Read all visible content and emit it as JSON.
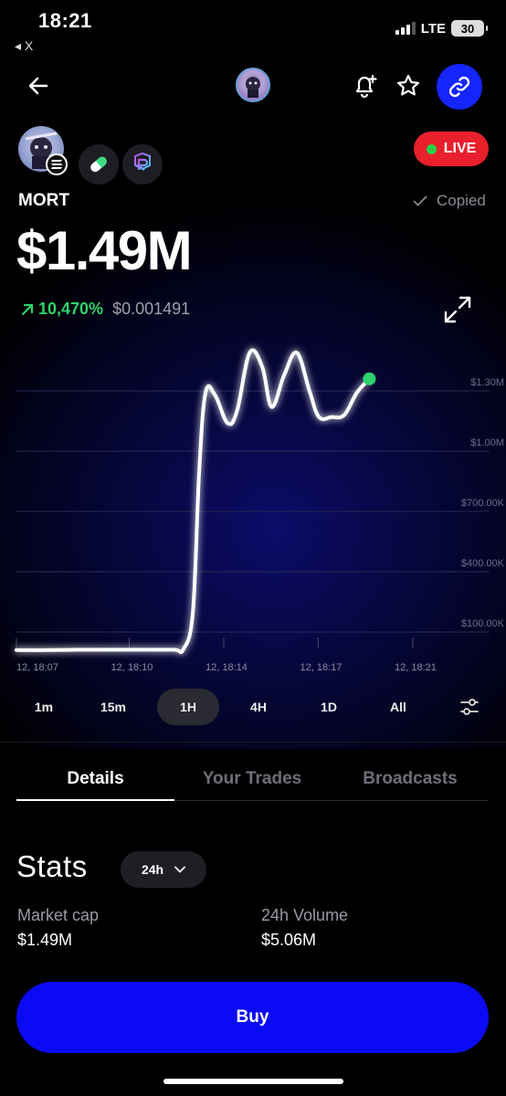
{
  "status_bar": {
    "time": "18:21",
    "back_app": "◂ X",
    "network": "LTE",
    "battery": "30"
  },
  "colors": {
    "accent_blue": "#1525ff",
    "buy_blue": "#0a0af6",
    "live_red": "#e8202c",
    "gain_green": "#2ed36b",
    "line": "#ffffff"
  },
  "header": {
    "icons": [
      "back-arrow-icon",
      "token-avatar",
      "bell-plus-icon",
      "star-icon",
      "link-icon"
    ]
  },
  "token": {
    "chain_icons": [
      "solana-icon",
      "pill-icon",
      "raydium-icon"
    ],
    "live_label": "LIVE",
    "ticker": "MORT",
    "copied_label": "Copied",
    "market_cap": "$1.49M",
    "change": "10,470%",
    "price": "$0.001491"
  },
  "chart_data": {
    "type": "line",
    "x": [
      "12, 18:07",
      "12, 18:10",
      "12, 18:14",
      "12, 18:17",
      "12, 18:21"
    ],
    "y_ticks": [
      "$1.30M",
      "$1.00M",
      "$700.00K",
      "$400.00K",
      "$100.00K"
    ],
    "ylim": [
      40000,
      1600000
    ],
    "grid": true,
    "series": [
      {
        "points": [
          [
            0.0,
            10000
          ],
          [
            1.0,
            10000
          ],
          [
            2.0,
            12000
          ],
          [
            3.0,
            12000
          ],
          [
            4.0,
            12000
          ],
          [
            5.0,
            12000
          ],
          [
            5.3,
            15000
          ],
          [
            5.6,
            200000
          ],
          [
            5.8,
            900000
          ],
          [
            6.0,
            1290000
          ],
          [
            6.3,
            1280000
          ],
          [
            6.7,
            1140000
          ],
          [
            7.0,
            1200000
          ],
          [
            7.4,
            1490000
          ],
          [
            7.8,
            1420000
          ],
          [
            8.1,
            1220000
          ],
          [
            8.5,
            1380000
          ],
          [
            8.9,
            1490000
          ],
          [
            9.3,
            1300000
          ],
          [
            9.6,
            1170000
          ],
          [
            10.0,
            1170000
          ],
          [
            10.4,
            1180000
          ],
          [
            10.8,
            1290000
          ],
          [
            11.2,
            1360000
          ]
        ]
      }
    ]
  },
  "ranges": {
    "items": [
      "1m",
      "15m",
      "1H",
      "4H",
      "1D",
      "All"
    ],
    "active": "1H"
  },
  "tabs": [
    "Details",
    "Your Trades",
    "Broadcasts"
  ],
  "stats": {
    "title": "Stats",
    "period": "24h",
    "items": [
      {
        "label": "Market cap",
        "value": "$1.49M"
      },
      {
        "label": "24h Volume",
        "value": "$5.06M"
      }
    ]
  },
  "buy_label": "Buy"
}
